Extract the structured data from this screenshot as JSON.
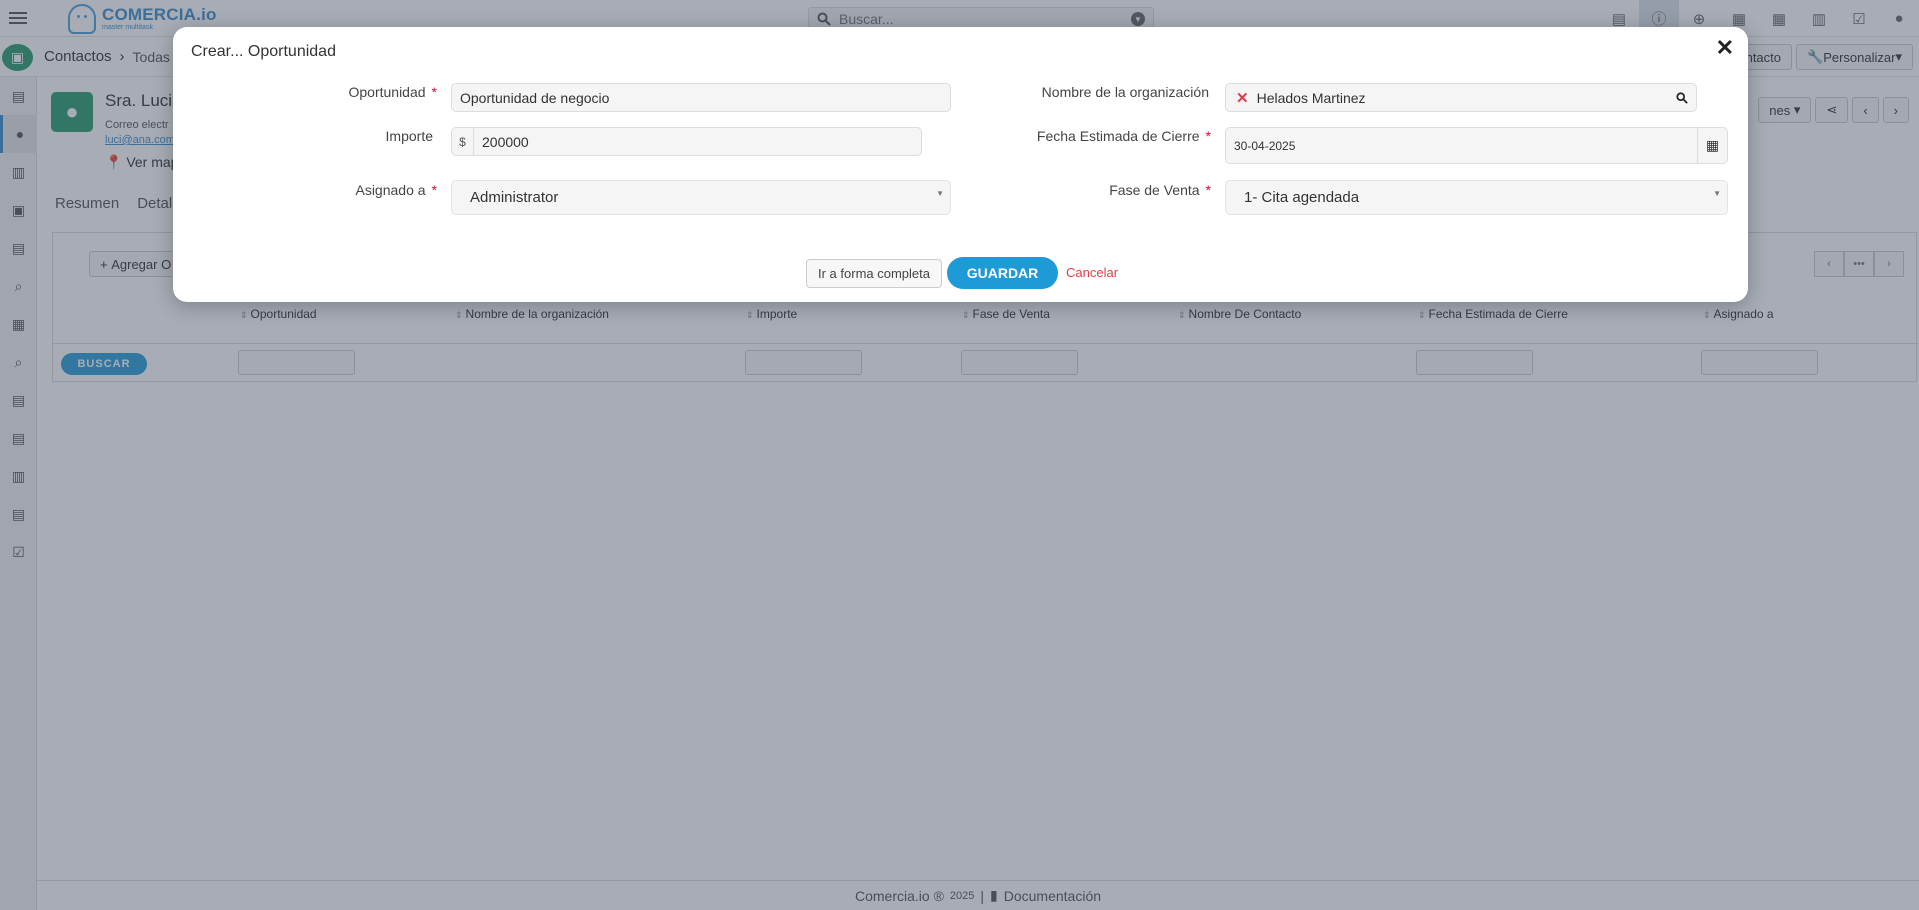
{
  "app": {
    "logo_name": "COMERCIA.io",
    "logo_sub": "master multitask",
    "search_placeholder": "Buscar..."
  },
  "breadcrumb": {
    "module": "Contactos",
    "view": "Todas"
  },
  "subbar": {
    "contact_btn": "ntacto",
    "customize_btn": "Personalizar"
  },
  "record": {
    "name": "Sra. Lucia",
    "email_label": "Correo electr",
    "email": "luci@ana.com",
    "map_link": "Ver mapa",
    "tabs": [
      "Resumen",
      "Detal"
    ],
    "actions_btn": "nes"
  },
  "list": {
    "add_btn": "Agregar O",
    "columns": [
      "Oportunidad",
      "Nombre de la organización",
      "Importe",
      "Fase de Venta",
      "Nombre De Contacto",
      "Fecha Estimada de Cierre",
      "Asignado a"
    ],
    "search_btn": "BUSCAR"
  },
  "footer": {
    "brand": "Comercia.io ®",
    "year": "2025",
    "separator": "|",
    "docs": "Documentación"
  },
  "modal": {
    "title": "Crear... Oportunidad",
    "fields": {
      "opportunity": {
        "label": "Oportunidad",
        "value": "Oportunidad de negocio"
      },
      "amount": {
        "label": "Importe",
        "currency": "$",
        "value": "200000"
      },
      "assigned": {
        "label": "Asignado a",
        "value": "Administrator"
      },
      "organization": {
        "label": "Nombre de la organización",
        "value": "Helados Martinez"
      },
      "close_date": {
        "label": "Fecha Estimada de Cierre",
        "value": "30-04-2025"
      },
      "stage": {
        "label": "Fase de Venta",
        "value": "1- Cita agendada"
      }
    },
    "required_mark": "*",
    "buttons": {
      "full_form": "Ir a forma completa",
      "save": "GUARDAR",
      "cancel": "Cancelar"
    }
  }
}
